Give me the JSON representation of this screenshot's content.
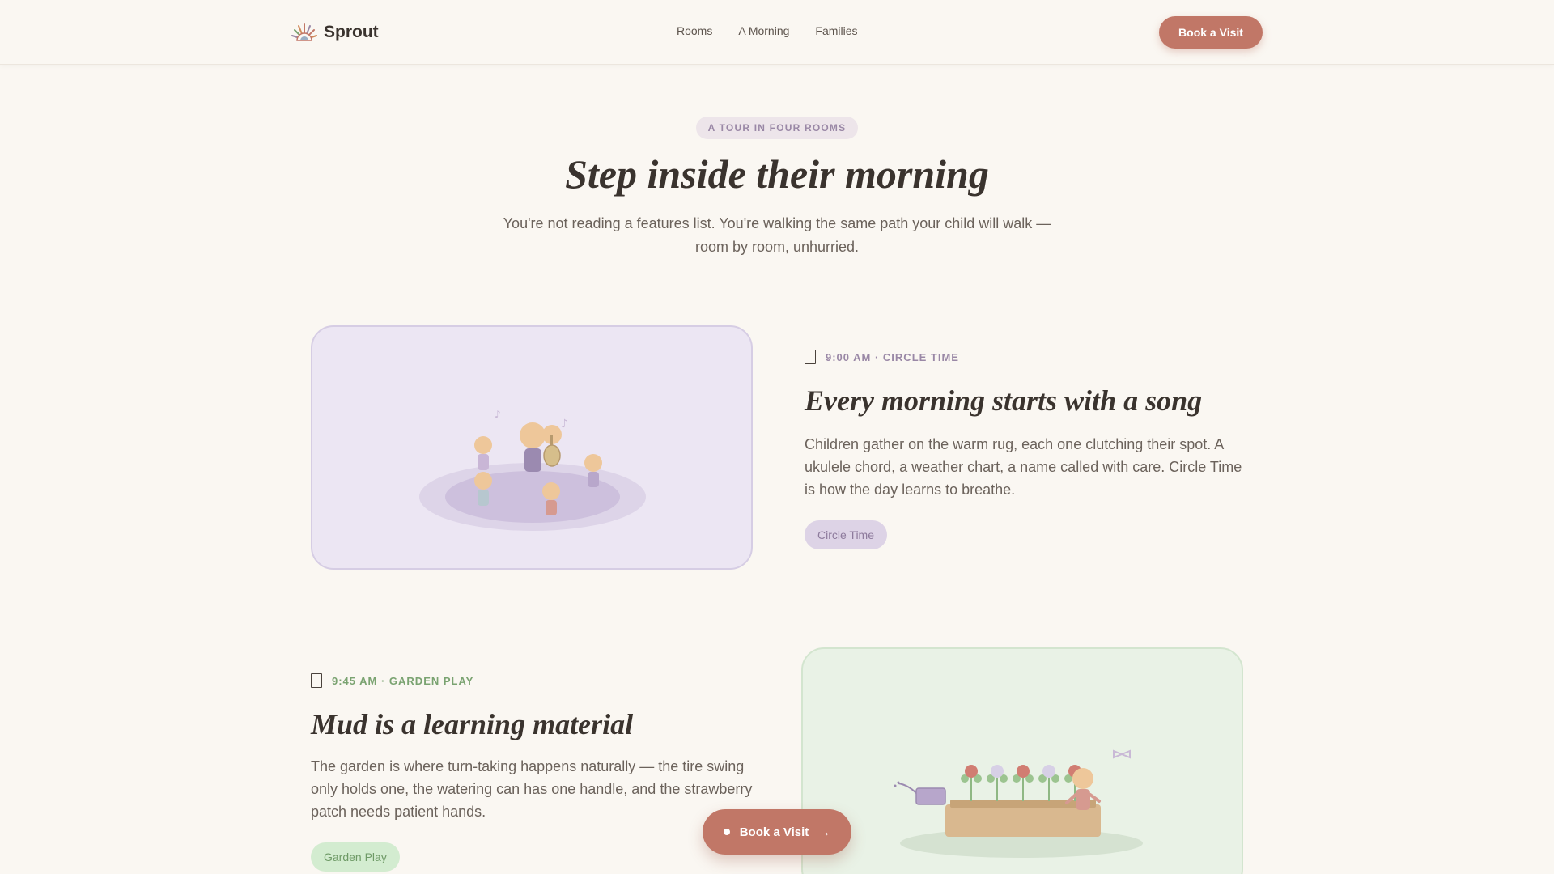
{
  "nav": {
    "brand": "Sprout",
    "links": [
      "Rooms",
      "A Morning",
      "Families"
    ],
    "cta": "Book a Visit"
  },
  "hero": {
    "eyebrow": "A TOUR IN FOUR ROOMS",
    "title": "Step inside their morning",
    "subtitle": "You're not reading a features list. You're walking the same path your child will walk — room by room, unhurried."
  },
  "sections": [
    {
      "meta": "9:00 AM · CIRCLE TIME",
      "meta_color": "#9a88a6",
      "title": "Every morning starts with a song",
      "body": "Children gather on the warm rug, each one clutching their spot. A ukulele chord, a weather chart, a name called with care. Circle Time is how the day learns to breathe.",
      "chip": "Circle Time",
      "chip_bg": "#ddd3e6",
      "chip_color": "#8d7a9c"
    },
    {
      "meta": "9:45 AM · GARDEN PLAY",
      "meta_color": "#7aa371",
      "title": "Mud is a learning material",
      "body": "The garden is where turn-taking happens naturally — the tire swing only holds one, the watering can has one handle, and the strawberry patch needs patient hands.",
      "chip": "Garden Play",
      "chip_bg": "#d3ecd0",
      "chip_color": "#6e9a66"
    }
  ],
  "floating_cta": {
    "label": "Book a Visit",
    "arrow": "→"
  },
  "colors": {
    "accent": "#c17767",
    "background": "#faf7f2",
    "lavender": "#ece6f3",
    "mint": "#e9f2e6"
  }
}
